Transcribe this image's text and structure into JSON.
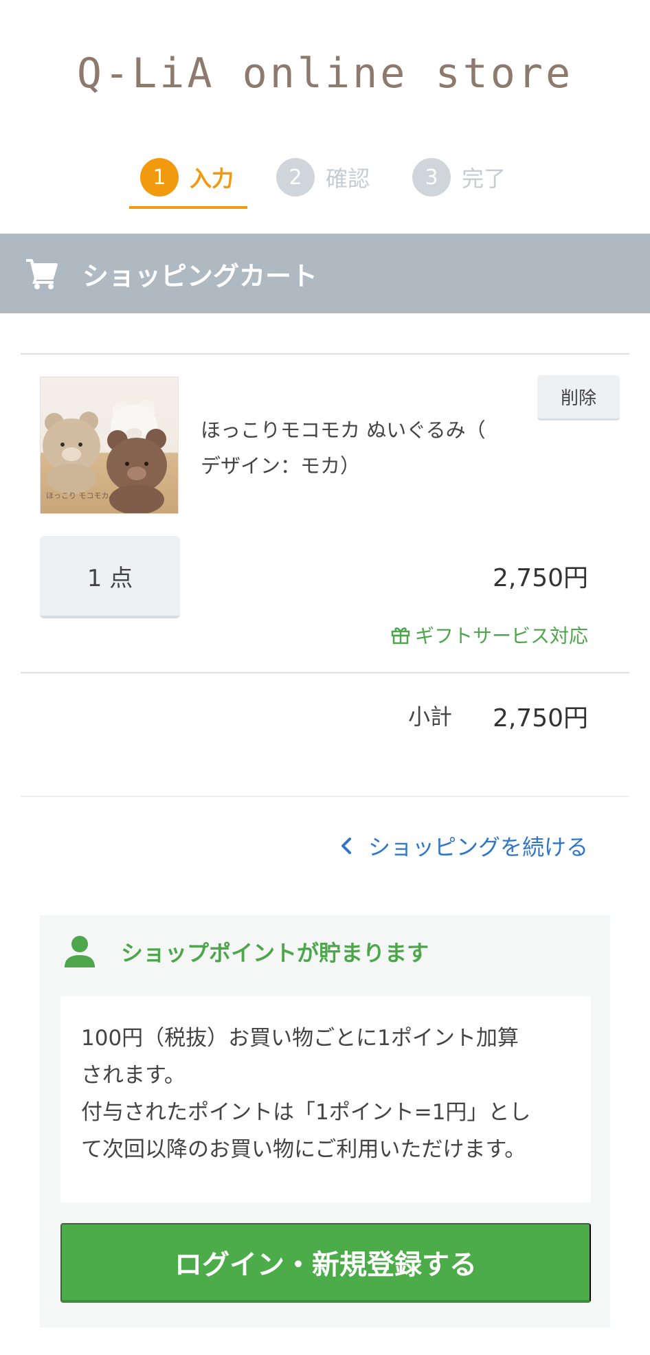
{
  "header": {
    "logo": "Q-LiA online store"
  },
  "steps": [
    {
      "number": "1",
      "label": "入力",
      "active": true
    },
    {
      "number": "2",
      "label": "確認",
      "active": false
    },
    {
      "number": "3",
      "label": "完了",
      "active": false
    }
  ],
  "cart": {
    "title": "ショッピングカート",
    "icon": "cart-icon",
    "item": {
      "name_line1": "ほっこりモコモカ ぬいぐるみ（",
      "name_line2": "デザイン：モカ）",
      "image_text": "ほっこり モコモカ。",
      "delete_label": "削除",
      "quantity_label": "1 点",
      "price": "2,750円",
      "gift_label": "ギフトサービス対応"
    },
    "subtotal_label": "小計",
    "subtotal_value": "2,750円",
    "continue_label": "ショッピングを続ける"
  },
  "points": {
    "heading": "ショップポイントが貯まります",
    "description_lines": [
      "100円（税抜）お買い物ごとに1ポイント加算",
      "されます。",
      "付与されたポイントは「1ポイント=1円」とし",
      "て次回以降のお買い物にご利用いただけます。"
    ],
    "login_label": "ログイン・新規登録する"
  },
  "colors": {
    "accent_orange": "#f29a0f",
    "header_bar": "#aeb9c1",
    "green": "#4ea64c",
    "link_blue": "#2f75c9"
  }
}
